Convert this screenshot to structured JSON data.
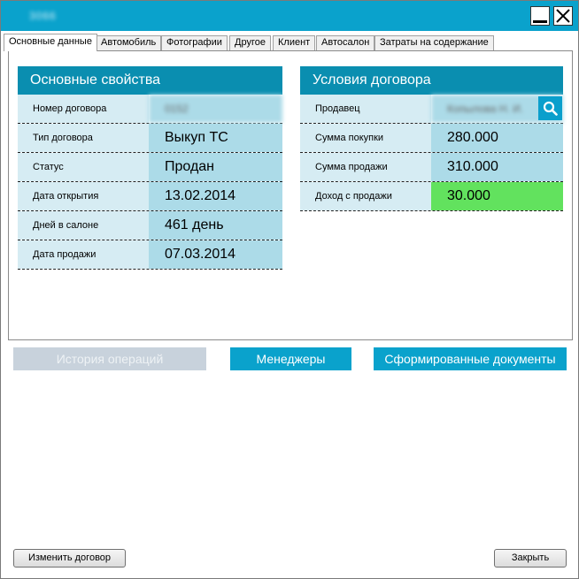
{
  "window": {
    "title": "3066"
  },
  "tabs": [
    {
      "label": "Основные данные",
      "active": true
    },
    {
      "label": "Автомобиль"
    },
    {
      "label": "Фотографии"
    },
    {
      "label": "Другое"
    },
    {
      "label": "Клиент"
    },
    {
      "label": "Автосалон"
    },
    {
      "label": "Затраты на содержание"
    }
  ],
  "basic_properties": {
    "title": "Основные свойства",
    "rows": [
      {
        "label": "Номер договора",
        "value": "0152"
      },
      {
        "label": "Тип договора",
        "value": "Выкуп ТС"
      },
      {
        "label": "Статус",
        "value": "Продан"
      },
      {
        "label": "Дата открытия",
        "value": "13.02.2014"
      },
      {
        "label": "Дней в салоне",
        "value": "461 день"
      },
      {
        "label": "Дата продажи",
        "value": "07.03.2014"
      }
    ]
  },
  "contract_terms": {
    "title": "Условия договора",
    "rows": [
      {
        "label": "Продавец",
        "value": "Копылова Н. И."
      },
      {
        "label": "Сумма покупки",
        "value": "280.000"
      },
      {
        "label": "Сумма продажи",
        "value": "310.000"
      },
      {
        "label": "Доход с продажи",
        "value": "30.000"
      }
    ],
    "income_color": "#62e25e"
  },
  "actions": {
    "history": "История операций",
    "managers": "Менеджеры",
    "documents": "Сформированные документы"
  },
  "footer": {
    "edit": "Изменить договор",
    "close": "Закрыть"
  },
  "icons": {
    "minimize": "minimize-icon",
    "close": "close-icon",
    "search": "search-icon"
  }
}
